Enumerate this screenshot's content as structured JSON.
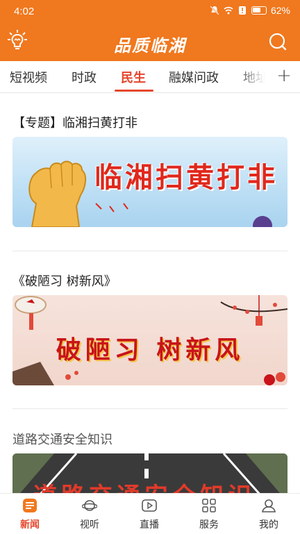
{
  "status": {
    "time": "4:02",
    "battery": "62%"
  },
  "app": {
    "logo_text": "品质临湘"
  },
  "tabs": [
    {
      "label": "短视频"
    },
    {
      "label": "时政"
    },
    {
      "label": "民生"
    },
    {
      "label": "融媒问政"
    },
    {
      "label": "地址"
    }
  ],
  "active_tab": "民生",
  "feed": [
    {
      "title": "【专题】临湘扫黄打非",
      "banner_text": "临湘扫黄打非"
    },
    {
      "title": "《破陋习 树新风》",
      "banner_text": "破陋习 树新风"
    },
    {
      "title": "道路交通安全知识",
      "banner_text": "道路交通安全知识"
    }
  ],
  "nav": [
    {
      "label": "新闻",
      "icon": "news-icon"
    },
    {
      "label": "视听",
      "icon": "planet-icon"
    },
    {
      "label": "直播",
      "icon": "play-icon"
    },
    {
      "label": "服务",
      "icon": "grid-icon"
    },
    {
      "label": "我的",
      "icon": "user-icon"
    }
  ],
  "colors": {
    "brand": "#f0781e",
    "accent": "#e5462b"
  }
}
